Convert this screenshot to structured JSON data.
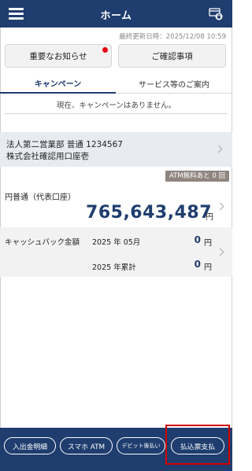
{
  "header": {
    "title": "ホーム",
    "menu_icon": "hamburger-menu-icon",
    "right_icon": "card-lock-icon"
  },
  "last_update": "最終更新日時：2025/12/08 10:59",
  "notices": {
    "important": "重要なお知らせ",
    "confirm": "ご確認事項"
  },
  "tabs": [
    {
      "label": "キャンペーン",
      "active": true
    },
    {
      "label": "サービス等のご案内",
      "active": false
    }
  ],
  "campaign_message": "現在、キャンペーンはありません。",
  "account": {
    "line1": "法人第二営業部 普通 1234567",
    "line2": "株式会社確認用口座壱"
  },
  "atm_badge": "ATM無料あと 0 回",
  "balance_section": {
    "account_type": "円普通（代表口座）",
    "amount": "765,643,487",
    "currency": "円"
  },
  "cashback": {
    "label": "キャッシュバック金額",
    "month_label": "2025 年 05月",
    "month_value": "0",
    "total_label": "2025 年累計",
    "total_value": "0",
    "unit": "円"
  },
  "bottom_nav": [
    "入出金明細",
    "スマホ ATM",
    "デビット後払い",
    "払込票支払"
  ],
  "colors": {
    "primary": "#1f3d6e",
    "alert": "#e60012",
    "highlight": "#d40000"
  }
}
